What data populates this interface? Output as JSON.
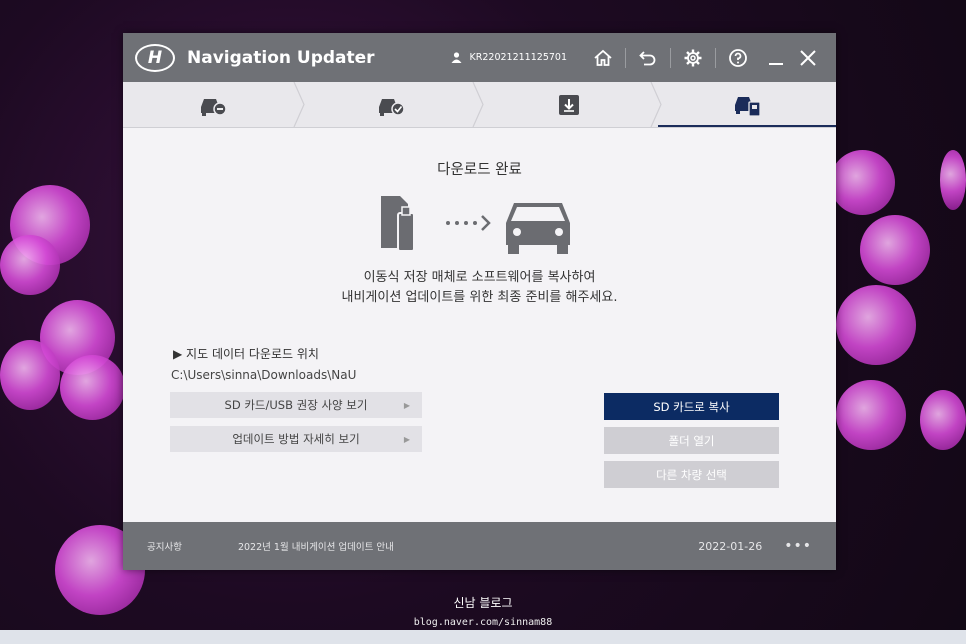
{
  "app": {
    "title": "Navigation Updater",
    "logo_text": "H",
    "user_id": "KR22021211125701"
  },
  "titlebar": {
    "icons": [
      "home-icon",
      "back-icon",
      "gear-icon",
      "help-icon",
      "minimize-icon",
      "close-icon"
    ]
  },
  "steps": [
    {
      "icon": "car-minus-icon",
      "active": false
    },
    {
      "icon": "car-check-icon",
      "active": false
    },
    {
      "icon": "download-box-icon",
      "active": false
    },
    {
      "icon": "car-copy-icon",
      "active": true
    }
  ],
  "main": {
    "title": "다운로드 완료",
    "message_line1": "이동식 저장 매체로 소프트웨어를 복사하여",
    "message_line2": "내비게이션 업데이트를 위한 최종 준비를 해주세요.",
    "location_title": "▶ 지도 데이터 다운로드 위치",
    "location_path": "C:\\Users\\sinna\\Downloads\\NaU",
    "spec_button": "SD 카드/USB 권장 사양 보기",
    "howto_button": "업데이트 방법 자세히 보기",
    "copy_sd_button": "SD 카드로 복사",
    "open_folder_button": "폴더 열기",
    "other_vehicle_button": "다른 차량 선택"
  },
  "footer": {
    "notice_label": "공지사항",
    "notice_text": "2022년 1월 내비게이션 업데이트 안내",
    "notice_date": "2022-01-26",
    "more": "•••"
  },
  "photo": {
    "caption": "신남 블로그",
    "caption_url": "blog.naver.com/sinnam88"
  },
  "colors": {
    "titlebar": "#6f7176",
    "primary": "#0c2b63",
    "content_bg": "#f4f3f6"
  }
}
